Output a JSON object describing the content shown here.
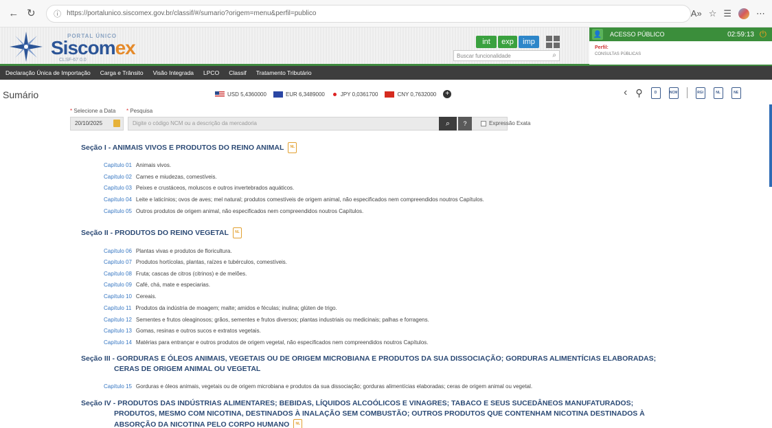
{
  "browser": {
    "url": "https://portalunico.siscomex.gov.br/classif/#/sumario?origem=menu&perfil=publico"
  },
  "header": {
    "logo_top": "PORTAL ÚNICO",
    "logo_main": "Siscom",
    "logo_accent": "ex",
    "logo_version": "CLSF-67 0.0",
    "btn_int": "int",
    "btn_exp": "exp",
    "btn_imp": "imp",
    "search_placeholder": "Buscar funcionalidade",
    "acesso": "ACESSO PÚBLICO",
    "timer": "02:59:13",
    "perfil_label": "Perfil:",
    "perfil_value": "CONSULTAS PÚBLICAS"
  },
  "nav": {
    "items": [
      "Declaração Única de Importação",
      "Carga e Trânsito",
      "Visão Integrada",
      "LPCO",
      "Classif",
      "Tratamento Tributário"
    ]
  },
  "title": "Sumário",
  "rates": [
    {
      "flag": "usd",
      "label": "USD 5,4360000"
    },
    {
      "flag": "eur",
      "label": "EUR 6,3489000"
    },
    {
      "flag": "jpy",
      "label": "JPY 0,0361700"
    },
    {
      "flag": "cny",
      "label": "CNY 0,7632000"
    }
  ],
  "tools": [
    "D",
    "NCM",
    "RGI",
    "NL",
    "NE"
  ],
  "form": {
    "date_label": "Selecione a Data",
    "date_value": "20/10/2025",
    "search_label": "Pesquisa",
    "search_placeholder": "Digite o código NCM ou a descrição da mercadoria",
    "help": "?",
    "exact": "Expressão Exata"
  },
  "sections": [
    {
      "title": "Seção I - ANIMAIS VIVOS E PRODUTOS DO REINO ANIMAL",
      "icon": "NL",
      "chapters": [
        {
          "label": "Capítulo 01",
          "desc": "Animais vivos."
        },
        {
          "label": "Capítulo 02",
          "desc": "Carnes e miudezas, comestíveis."
        },
        {
          "label": "Capítulo 03",
          "desc": "Peixes e crustáceos, moluscos e outros invertebrados aquáticos."
        },
        {
          "label": "Capítulo 04",
          "desc": "Leite e laticínios; ovos de aves; mel natural; produtos comestíveis de origem animal, não especificados nem compreendidos noutros Capítulos."
        },
        {
          "label": "Capítulo 05",
          "desc": "Outros produtos de origem animal, não especificados nem compreendidos noutros Capítulos."
        }
      ]
    },
    {
      "title": "Seção II - PRODUTOS DO REINO VEGETAL",
      "icon": "NL",
      "chapters": [
        {
          "label": "Capítulo 06",
          "desc": "Plantas vivas e produtos de floricultura."
        },
        {
          "label": "Capítulo 07",
          "desc": "Produtos hortícolas, plantas, raízes e tubérculos, comestíveis."
        },
        {
          "label": "Capítulo 08",
          "desc": "Fruta; cascas de citros (citrinos) e de melões."
        },
        {
          "label": "Capítulo 09",
          "desc": "Café, chá, mate e especiarias."
        },
        {
          "label": "Capítulo 10",
          "desc": "Cereais."
        },
        {
          "label": "Capítulo 11",
          "desc": "Produtos da indústria de moagem; malte; amidos e féculas; inulina; glúten de trigo."
        },
        {
          "label": "Capítulo 12",
          "desc": "Sementes e frutos oleaginosos; grãos, sementes e frutos diversos; plantas industriais ou medicinais; palhas e forragens."
        },
        {
          "label": "Capítulo 13",
          "desc": "Gomas, resinas e outros sucos e extratos vegetais."
        },
        {
          "label": "Capítulo 14",
          "desc": "Matérias para entrançar e outros produtos de origem vegetal, não especificados nem compreendidos noutros Capítulos."
        }
      ]
    },
    {
      "title_line1": "Seção III - GORDURAS E ÓLEOS ANIMAIS, VEGETAIS OU DE ORIGEM MICROBIANA E PRODUTOS DA SUA DISSOCIAÇÃO; GORDURAS ALIMENTÍCIAS ELABORADAS;",
      "title_line2": "CERAS DE ORIGEM ANIMAL OU VEGETAL",
      "chapters": [
        {
          "label": "Capítulo 15",
          "desc": "Gorduras e óleos animais, vegetais ou de origem microbiana e produtos da sua dissociação; gorduras alimentícias elaboradas; ceras de origem animal ou vegetal."
        }
      ]
    },
    {
      "title_line1": "Seção IV - PRODUTOS DAS INDÚSTRIAS ALIMENTARES; BEBIDAS, LÍQUIDOS ALCOÓLICOS E VINAGRES; TABACO E SEUS SUCEDÂNEOS MANUFATURADOS;",
      "title_line2": "PRODUTOS, MESMO COM NICOTINA, DESTINADOS À INALAÇÃO SEM COMBUSTÃO; OUTROS PRODUTOS QUE CONTENHAM NICOTINA DESTINADOS À",
      "title_line3": "ABSORÇÃO DA NICOTINA PELO CORPO HUMANO",
      "icon": "NL"
    }
  ]
}
